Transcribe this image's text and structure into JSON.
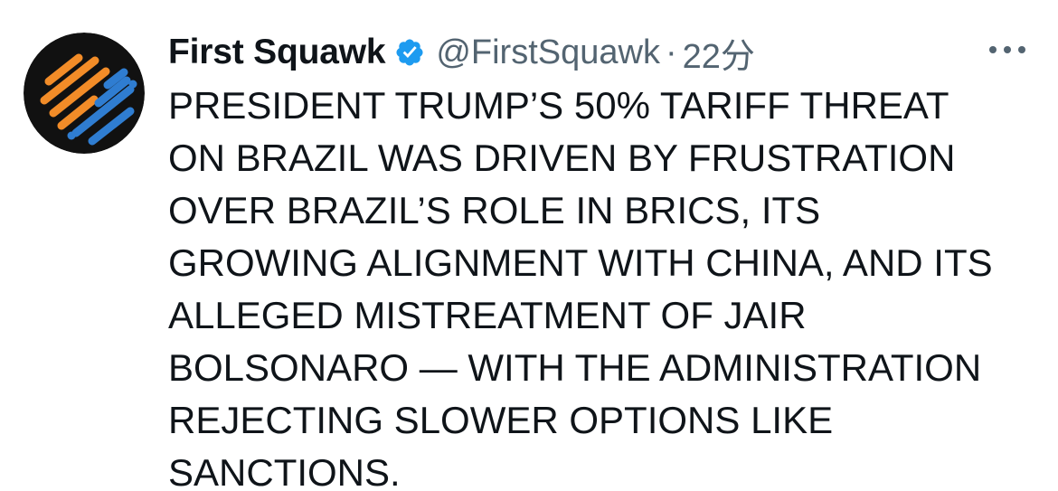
{
  "account": {
    "name": "First Squawk",
    "handle": "@FirstSquawk",
    "separator": "·",
    "time": "22分",
    "verified": true,
    "verified_icon": "verified-badge-icon",
    "avatar_icon": "first-squawk-logo-icon"
  },
  "tweet": {
    "lines": [
      "PRESIDENT TRUMP’S 50% TARIFF THREAT",
      "ON BRAZIL WAS DRIVEN BY FRUSTRATION",
      "OVER BRAZIL’S ROLE IN BRICS, ITS",
      "GROWING ALIGNMENT WITH CHINA, AND ITS",
      "ALLEGED MISTREATMENT OF JAIR",
      "BOLSONARO — WITH THE ADMINISTRATION",
      "REJECTING SLOWER OPTIONS LIKE",
      "SANCTIONS."
    ]
  },
  "actions": {
    "more_icon": "more-horizontal-icon"
  },
  "colors": {
    "text": "#0f1419",
    "secondary_text": "#536471",
    "verified_blue": "#1d9bf0",
    "logo_orange": "#f28c28",
    "logo_blue": "#2f7dd1",
    "avatar_bg": "#111111"
  }
}
